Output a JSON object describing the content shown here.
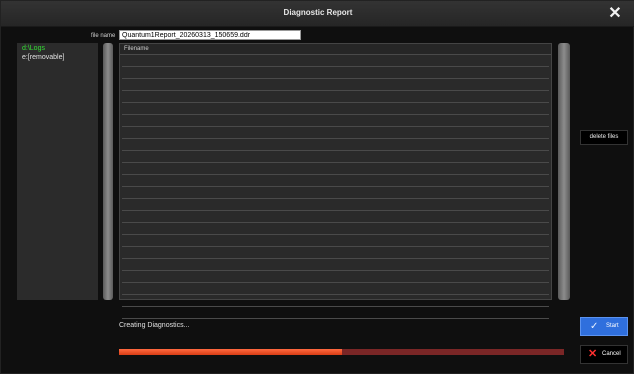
{
  "window": {
    "title": "Diagnostic Report",
    "close_icon": "close-icon"
  },
  "filename_field": {
    "label": "file name",
    "value": "Quantum1Report_20260313_150659.ddr"
  },
  "drives": [
    {
      "label": "d:\\Logs",
      "selected": true,
      "color": "#33dd33"
    },
    {
      "label": "e:[removable]",
      "selected": false
    }
  ],
  "file_list": {
    "column_header": "Filename",
    "rows": 22
  },
  "buttons": {
    "delete_label": "delete files",
    "start_label": "Start",
    "start_icon": "check-icon",
    "cancel_label": "Cancel",
    "cancel_icon": "x-icon"
  },
  "status": {
    "text": "Creating Diagnostics..."
  },
  "progress": {
    "fraction": 0.5,
    "fill_color": "#ff5a30",
    "track_color": "#7a2626"
  },
  "colors": {
    "accent_blue": "#2f6fdd",
    "cancel_red": "#ff3030"
  }
}
